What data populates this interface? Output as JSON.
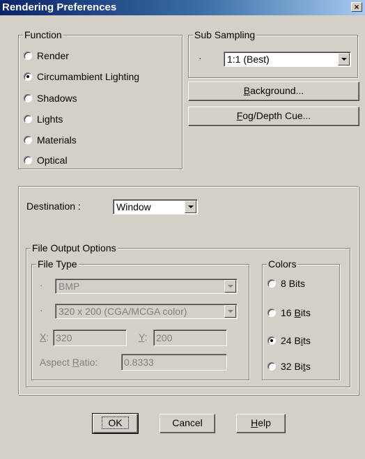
{
  "window": {
    "title": "Rendering Preferences",
    "close_glyph": "×"
  },
  "function": {
    "label": "Function",
    "options": [
      {
        "label": "Render",
        "checked": false
      },
      {
        "label": "Circumambient Lighting",
        "checked": true
      },
      {
        "label": "Shadows",
        "checked": false
      },
      {
        "label": "Lights",
        "checked": false
      },
      {
        "label": "Materials",
        "checked": false
      },
      {
        "label": "Optical",
        "checked": false
      }
    ]
  },
  "sub_sampling": {
    "label": "Sub Sampling",
    "dash": "·",
    "value": "1:1 (Best)"
  },
  "buttons": {
    "background": {
      "pre": "",
      "key": "B",
      "post": "ackground..."
    },
    "fog": {
      "pre": "",
      "key": "F",
      "post": "og/Depth Cue..."
    }
  },
  "destination": {
    "label": "Destination :",
    "value": "Window"
  },
  "file_output": {
    "label": "File Output Options",
    "file_type": {
      "label": "File Type",
      "dash": "·",
      "format_value": "BMP",
      "resolution_value": "320 x 200 (CGA/MCGA color)",
      "x_label_key": "X",
      "x_label_post": ":",
      "x_value": "320",
      "y_label_key": "Y",
      "y_label_post": ":",
      "y_value": "200",
      "aspect_pre": "Aspect ",
      "aspect_key": "R",
      "aspect_post": "atio:",
      "aspect_value": "0.8333"
    },
    "colors": {
      "label": "Colors",
      "options": [
        {
          "pre": "8 Bits",
          "key": "",
          "post": "",
          "checked": false
        },
        {
          "pre": "16 ",
          "key": "B",
          "post": "its",
          "checked": false
        },
        {
          "pre": "24 B",
          "key": "i",
          "post": "ts",
          "checked": true
        },
        {
          "pre": "32 Bi",
          "key": "t",
          "post": "s",
          "checked": false
        }
      ]
    }
  },
  "footer": {
    "ok": "OK",
    "cancel": "Cancel",
    "help_key": "H",
    "help_post": "elp"
  }
}
